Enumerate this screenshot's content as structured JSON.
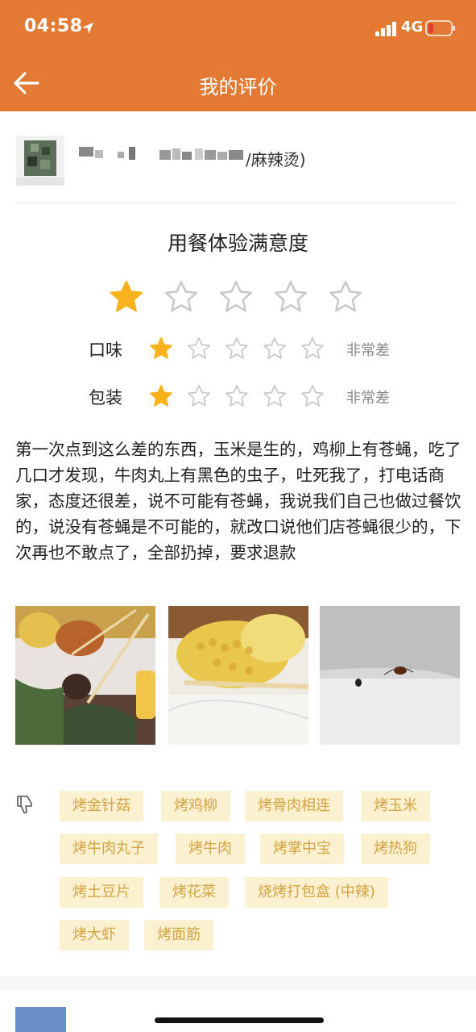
{
  "status_bar": {
    "time": "04:58",
    "network": "4G"
  },
  "nav": {
    "title": "我的评价"
  },
  "store": {
    "name_suffix": "/麻辣烫)"
  },
  "rating": {
    "title": "用餐体验满意度",
    "overall_stars": 1,
    "max_stars": 5,
    "sub": [
      {
        "label": "口味",
        "stars": 1,
        "verdict": "非常差"
      },
      {
        "label": "包装",
        "stars": 1,
        "verdict": "非常差"
      }
    ]
  },
  "review": {
    "text": "第一次点到这么差的东西，玉米是生的，鸡柳上有苍蝇，吃了几口才发现，牛肉丸上有黑色的虫子，吐死我了，打电话商家，态度还很差，说不可能有苍蝇，我说我们自己也做过餐饮的，说没有苍蝇是不可能的，就改口说他们店苍蝇很少的，下次再也不敢点了，全部扔掉，要求退款"
  },
  "disliked_items": [
    "烤金针菇",
    "烤鸡柳",
    "烤骨肉相连",
    "烤玉米",
    "烤牛肉丸子",
    "烤牛肉",
    "烤掌中宝",
    "烤热狗",
    "烤土豆片",
    "烤花菜",
    "烧烤打包盒 (中辣)",
    "烤大虾",
    "烤面筋"
  ],
  "colors": {
    "header": "#e27a34",
    "star_filled": "#f7b21c",
    "star_empty": "#c8c8c8",
    "tag_bg": "#fbf0cf",
    "tag_text": "#d4a343",
    "battery_low": "#e63b2e"
  },
  "icons": [
    "location-arrow-icon",
    "signal-icon",
    "battery-icon",
    "back-arrow-icon",
    "star-icon",
    "thumbs-down-icon"
  ]
}
